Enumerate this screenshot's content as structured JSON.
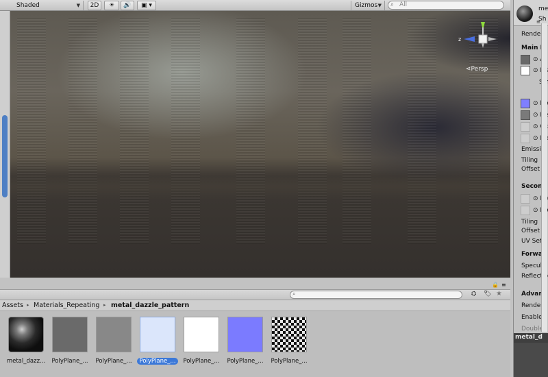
{
  "toolbar": {
    "shading_mode": "Shaded",
    "btn_2d": "2D",
    "lighting_icon": "sun-icon",
    "audio_icon": "speaker-icon",
    "effects_icon": "image-icon",
    "gizmos_label": "Gizmos",
    "search_placeholder": "All"
  },
  "viewport": {
    "projection_label": "Persp",
    "gizmo_x_label": "z"
  },
  "inspector": {
    "name_partial": "me",
    "shader_partial": "Sh",
    "rendering": "Renderi",
    "main_maps": "Main M",
    "albedo": "Al",
    "metallic": "Me",
    "smoothness": "Sm",
    "normal": "No",
    "height": "He",
    "occlusion": "Oc",
    "detail_mask": "De",
    "emission": "Emissio",
    "tiling": "Tiling",
    "offset": "Offset",
    "secondary": "Second",
    "detail_albedo": "De",
    "detail_normal": "No",
    "tiling2": "Tiling",
    "offset2": "Offset",
    "uv_set": "UV Set",
    "forward": "Forwar",
    "specular": "Specula",
    "reflections": "Reflectio",
    "advanced": "Advan",
    "render_queue": "Render",
    "enable_instancing": "Enable I",
    "double_sided": "Double",
    "bottom_asset": "metal_d",
    "colors": {
      "albedo": "#6a6a6a",
      "metallic": "#ffffff",
      "normal": "#7f7fff",
      "height": "#7a7a7a"
    }
  },
  "project": {
    "breadcrumb": [
      "Assets",
      "Materials_Repeating",
      "metal_dazzle_pattern"
    ],
    "assets": [
      {
        "label": "metal_dazz...",
        "type": "sphere"
      },
      {
        "label": "PolyPlane_...",
        "type": "dark-gray",
        "color": "#6a6a6a"
      },
      {
        "label": "PolyPlane_...",
        "type": "mid-gray",
        "color": "#888888"
      },
      {
        "label": "PolyPlane_...",
        "type": "light-blue",
        "color": "#dbe6fb",
        "selected": true
      },
      {
        "label": "PolyPlane_...",
        "type": "white",
        "color": "#ffffff"
      },
      {
        "label": "PolyPlane_...",
        "type": "normal-blue",
        "color": "#7b7bff"
      },
      {
        "label": "PolyPlane_...",
        "type": "checker"
      }
    ]
  }
}
